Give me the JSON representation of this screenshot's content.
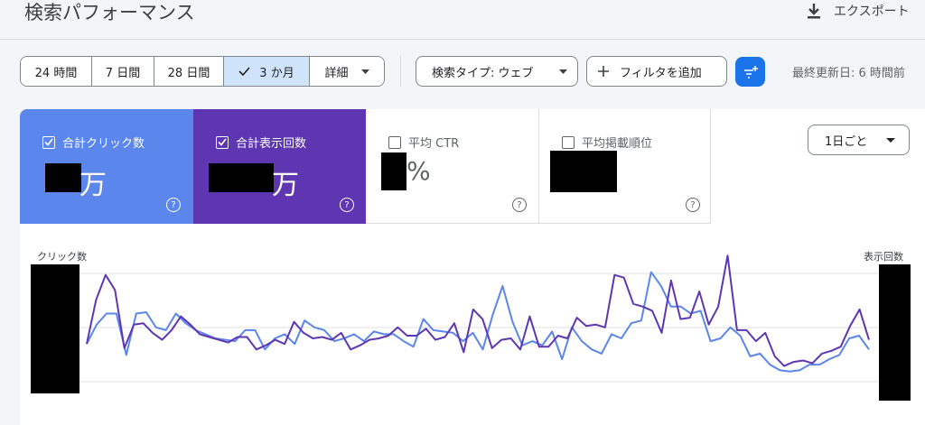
{
  "header": {
    "title": "検索パフォーマンス",
    "export_label": "エクスポート"
  },
  "toolbar": {
    "ranges": [
      {
        "label": "24 時間",
        "active": false
      },
      {
        "label": "7 日間",
        "active": false
      },
      {
        "label": "28 日間",
        "active": false
      },
      {
        "label": "3 か月",
        "active": true
      }
    ],
    "detail_label": "詳細",
    "search_type_label": "検索タイプ: ウェブ",
    "add_filter_label": "フィルタを追加",
    "last_updated": "最終更新日: 6 時間前"
  },
  "metrics": {
    "clicks": {
      "label": "合計クリック数",
      "unit": "万",
      "checked": true,
      "color": "#5b86ec"
    },
    "impressions": {
      "label": "合計表示回数",
      "unit": "万",
      "checked": true,
      "color": "#5e36b1"
    },
    "ctr": {
      "label": "平均 CTR",
      "unit": "%",
      "checked": false
    },
    "position": {
      "label": "平均掲載順位",
      "checked": false
    },
    "help_glyph": "?"
  },
  "interval": {
    "label": "1日ごと"
  },
  "chart": {
    "left_axis_label": "クリック数",
    "right_axis_label": "表示回数",
    "grid": true,
    "clicks_color": "#5b86ec",
    "impressions_color": "#5e36b1"
  },
  "chart_data": {
    "type": "line",
    "title": "",
    "xlabel": "",
    "ylabel": "クリック数",
    "y2label": "表示回数",
    "y_axis_values_hidden": true,
    "ylim": [
      0,
      100
    ],
    "series": [
      {
        "name": "合計クリック数",
        "values": [
          28,
          42,
          50,
          50,
          20,
          50,
          51,
          40,
          38,
          50,
          43,
          38,
          35,
          32,
          31,
          30,
          38,
          38,
          24,
          32,
          35,
          28,
          45,
          40,
          38,
          30,
          32,
          35,
          30,
          37,
          35,
          35,
          30,
          26,
          46,
          38,
          37,
          36,
          30,
          36,
          24,
          49,
          70,
          44,
          27,
          30,
          27,
          37,
          17,
          40,
          30,
          24,
          21,
          35,
          32,
          43,
          45,
          80,
          70,
          55,
          55,
          50,
          52,
          30,
          32,
          40,
          34,
          19,
          21,
          13,
          9,
          8,
          9,
          13,
          13,
          17,
          20,
          32,
          34,
          24
        ]
      },
      {
        "name": "合計表示回数",
        "values": [
          28,
          60,
          78,
          67,
          25,
          42,
          43,
          36,
          31,
          38,
          48,
          42,
          35,
          33,
          31,
          29,
          33,
          33,
          24,
          27,
          31,
          28,
          44,
          36,
          32,
          33,
          31,
          36,
          24,
          27,
          31,
          32,
          34,
          40,
          34,
          34,
          39,
          31,
          33,
          43,
          22,
          53,
          46,
          25,
          31,
          32,
          24,
          48,
          26,
          26,
          34,
          32,
          47,
          41,
          42,
          40,
          78,
          76,
          57,
          55,
          52,
          36,
          74,
          46,
          47,
          66,
          42,
          55,
          92,
          38,
          38,
          30,
          36,
          19,
          12,
          15,
          16,
          14,
          21,
          23,
          26,
          41,
          53,
          31
        ]
      }
    ]
  }
}
